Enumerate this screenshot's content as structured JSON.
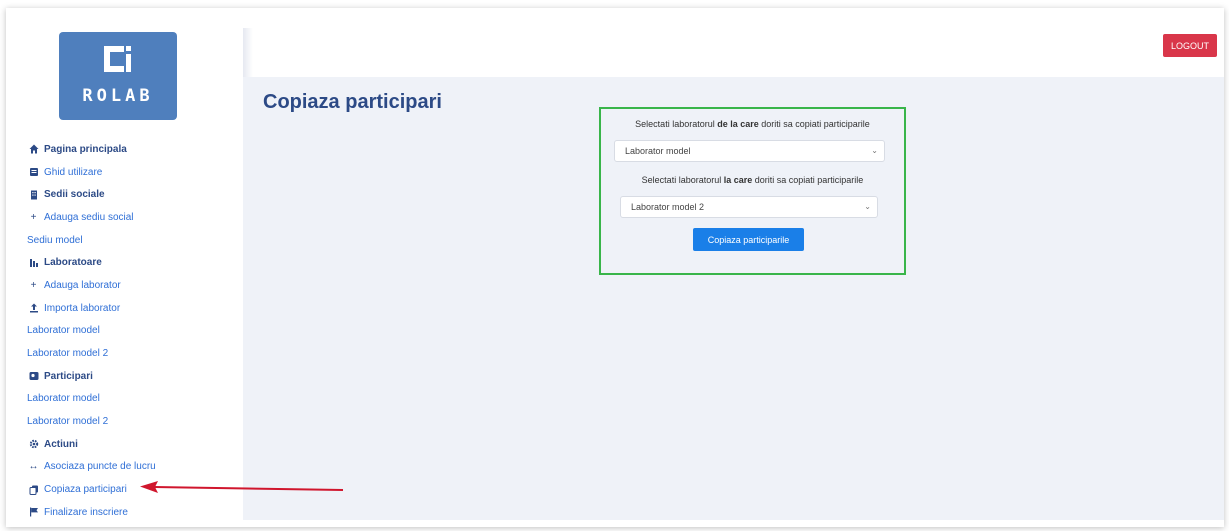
{
  "logo": {
    "text": "ROLAB"
  },
  "header": {
    "logout_label": "LOGOUT"
  },
  "sidebar": {
    "items": [
      {
        "label": "Pagina principala",
        "icon": "home-icon",
        "type": "section"
      },
      {
        "label": "Ghid utilizare",
        "icon": "book-icon",
        "type": "link"
      },
      {
        "label": "Sedii sociale",
        "icon": "building-icon",
        "type": "section"
      },
      {
        "label": "Adauga sediu social",
        "icon": "plus-icon",
        "type": "link"
      },
      {
        "label": "Sediu model",
        "icon": "",
        "type": "link"
      },
      {
        "label": "Laboratoare",
        "icon": "lab-icon",
        "type": "section"
      },
      {
        "label": "Adauga laborator",
        "icon": "plus-icon",
        "type": "link"
      },
      {
        "label": "Importa laborator",
        "icon": "upload-icon",
        "type": "link"
      },
      {
        "label": "Laborator model",
        "icon": "",
        "type": "link"
      },
      {
        "label": "Laborator model 2",
        "icon": "",
        "type": "link"
      },
      {
        "label": "Participari",
        "icon": "id-card-icon",
        "type": "section"
      },
      {
        "label": "Laborator model",
        "icon": "",
        "type": "link"
      },
      {
        "label": "Laborator model 2",
        "icon": "",
        "type": "link"
      },
      {
        "label": "Actiuni",
        "icon": "gear-icon",
        "type": "section"
      },
      {
        "label": "Asociaza puncte de lucru",
        "icon": "arrows-horizontal-icon",
        "type": "link"
      },
      {
        "label": "Copiaza participari",
        "icon": "copy-icon",
        "type": "link"
      },
      {
        "label": "Finalizare inscriere",
        "icon": "flag-icon",
        "type": "link"
      }
    ]
  },
  "main": {
    "title": "Copiaza participari",
    "form": {
      "source_label_pre": "Selectati laboratorul ",
      "source_label_bold": "de la care",
      "source_label_post": " doriti sa copiati participarile",
      "source_value": "Laborator model",
      "target_label_pre": "Selectati laboratorul ",
      "target_label_bold": "la care",
      "target_label_post": " doriti sa copiati participarile",
      "target_value": "Laborator model 2",
      "submit_label": "Copiaza participarile"
    }
  },
  "colors": {
    "accent": "#2f6fd6",
    "logout": "#d9364a",
    "highlight_border": "#39b54a",
    "annotation_arrow": "#d0162d",
    "primary_button": "#1a7fe8"
  }
}
